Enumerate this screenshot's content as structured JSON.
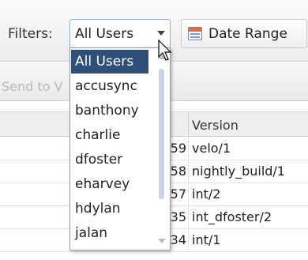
{
  "toolbar": {
    "filters_label": "Filters:",
    "filter_value": "All Users",
    "date_range_label": "Date Range"
  },
  "subbar": {
    "send_label": "Send to V"
  },
  "table": {
    "version_header": "Version",
    "rows": [
      {
        "num": "59",
        "version": "velo/1"
      },
      {
        "num": "58",
        "version": "nightly_build/1"
      },
      {
        "num": "57",
        "version": "int/2"
      },
      {
        "num": "35",
        "version": "int_dfoster/2"
      },
      {
        "num": "34",
        "version": "int/1"
      }
    ]
  },
  "dropdown": {
    "items": [
      {
        "label": "All Users"
      },
      {
        "label": "accusync"
      },
      {
        "label": "banthony"
      },
      {
        "label": "charlie"
      },
      {
        "label": "dfoster"
      },
      {
        "label": "eharvey"
      },
      {
        "label": "hdylan"
      },
      {
        "label": "jalan"
      }
    ]
  },
  "colors": {
    "selected_bg": "#2f4f7a",
    "select_border": "#8fb0d6",
    "calendar_accent": "#e06b3b"
  }
}
